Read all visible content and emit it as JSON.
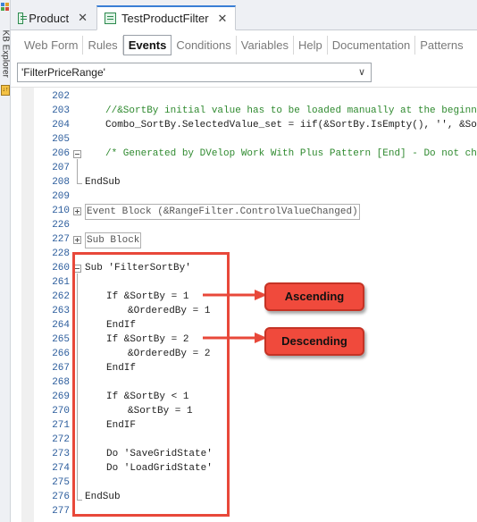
{
  "sidebar": {
    "label": "KB Explorer"
  },
  "doc_tabs": [
    {
      "label": "Product",
      "close": "✕"
    },
    {
      "label": "TestProductFilter",
      "close": "✕"
    }
  ],
  "sub_tabs": [
    "Web Form",
    "Rules",
    "Events",
    "Conditions",
    "Variables",
    "Help",
    "Documentation",
    "Patterns"
  ],
  "active_sub_tab": "Events",
  "event_selector": {
    "value": "'FilterPriceRange'"
  },
  "code_lines": [
    {
      "num": "202",
      "text": ""
    },
    {
      "num": "203",
      "text": "//&SortBy initial value has to be loaded manually at the beginning of"
    },
    {
      "num": "204",
      "text": "Combo_SortBy.SelectedValue_set = iif(&SortBy.IsEmpty(), '', &SortBy.To"
    },
    {
      "num": "205",
      "text": ""
    },
    {
      "num": "206",
      "text": "/* Generated by DVelop Work With Plus Pattern [End] - Do not change *"
    },
    {
      "num": "207",
      "text": ""
    },
    {
      "num": "208",
      "text": "EndSub"
    },
    {
      "num": "209",
      "text": ""
    },
    {
      "num": "210",
      "text": "Event Block (&RangeFilter.ControlValueChanged)"
    },
    {
      "num": "226",
      "text": ""
    },
    {
      "num": "227",
      "text": "Sub Block"
    },
    {
      "num": "228",
      "text": ""
    },
    {
      "num": "260",
      "text": "Sub 'FilterSortBy'"
    },
    {
      "num": "261",
      "text": ""
    },
    {
      "num": "262",
      "text": "If &SortBy = 1"
    },
    {
      "num": "263",
      "text": "&OrderedBy = 1"
    },
    {
      "num": "264",
      "text": "EndIf"
    },
    {
      "num": "265",
      "text": "If &SortBy = 2"
    },
    {
      "num": "266",
      "text": "&OrderedBy = 2"
    },
    {
      "num": "267",
      "text": "EndIf"
    },
    {
      "num": "268",
      "text": ""
    },
    {
      "num": "269",
      "text": "If &SortBy < 1"
    },
    {
      "num": "270",
      "text": "&SortBy = 1"
    },
    {
      "num": "271",
      "text": "EndIF"
    },
    {
      "num": "272",
      "text": ""
    },
    {
      "num": "273",
      "text": "Do 'SaveGridState'"
    },
    {
      "num": "274",
      "text": "Do 'LoadGridState'"
    },
    {
      "num": "275",
      "text": ""
    },
    {
      "num": "276",
      "text": "EndSub"
    },
    {
      "num": "277",
      "text": ""
    }
  ],
  "callouts": {
    "ascending": "Ascending",
    "descending": "Descending"
  },
  "colors": {
    "comment": "#2f8a2f",
    "string": "#a31515",
    "line_number": "#2b5c9c",
    "highlight": "#e8483a",
    "callout": "#f04a3c"
  }
}
